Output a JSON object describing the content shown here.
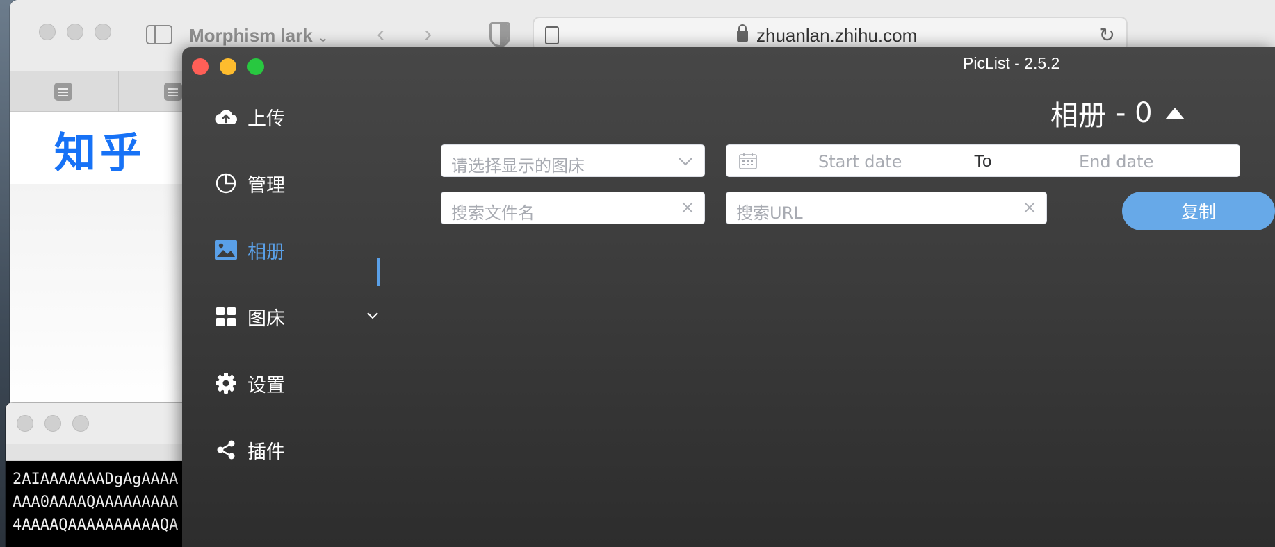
{
  "browser": {
    "tab_group": "Morphism lark",
    "url": "zhuanlan.zhihu.com",
    "page_logo": "知乎"
  },
  "terminal": {
    "lines": [
      "2AIAAAAAAADgAgAAAA",
      "AAA0AAAAQAAAAAAAAA",
      "4AAAAQAAAAAAAAAAQA"
    ]
  },
  "piclist": {
    "title": "PicList - 2.5.2",
    "nav": [
      {
        "label": "上传",
        "icon": "cloud-upload-icon"
      },
      {
        "label": "管理",
        "icon": "pie-chart-icon"
      },
      {
        "label": "相册",
        "icon": "image-icon",
        "active": true
      },
      {
        "label": "图床",
        "icon": "grid-icon",
        "expandable": true
      },
      {
        "label": "设置",
        "icon": "gear-icon"
      },
      {
        "label": "插件",
        "icon": "share-icon"
      }
    ],
    "album": {
      "title": "相册",
      "count": "- 0"
    },
    "filters": {
      "bed_select_placeholder": "请选择显示的图床",
      "start_date_placeholder": "Start date",
      "date_separator": "To",
      "end_date_placeholder": "End date",
      "filename_search_placeholder": "搜索文件名",
      "url_search_placeholder": "搜索URL",
      "copy_button": "复制"
    },
    "colors": {
      "accent": "#5aa0e8",
      "copy_button": "#67a9e8",
      "close": "#ff5f57",
      "minimize": "#febc2e",
      "zoom": "#28c840"
    }
  }
}
